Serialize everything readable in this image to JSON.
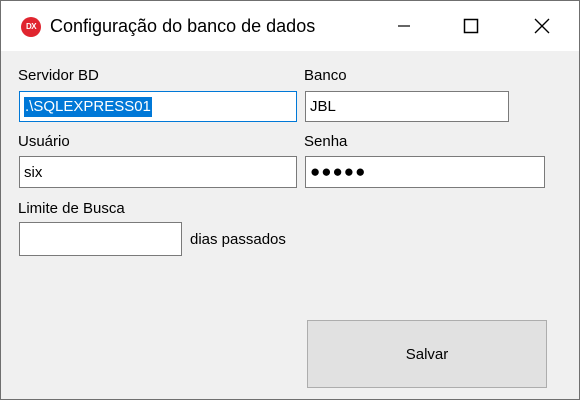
{
  "window": {
    "title": "Configuração do banco de dados",
    "icon_text": "DX",
    "icon_color": "#e0252f"
  },
  "form": {
    "servidor": {
      "label": "Servidor BD",
      "value": ".\\SQLEXPRESS01"
    },
    "banco": {
      "label": "Banco",
      "value": "JBL"
    },
    "usuario": {
      "label": "Usuário",
      "value": "six"
    },
    "senha": {
      "label": "Senha",
      "value": "●●●●●"
    },
    "limite": {
      "label": "Limite de Busca",
      "value": "",
      "suffix": "dias passados"
    }
  },
  "buttons": {
    "save_label": "Salvar"
  },
  "colors": {
    "selection": "#0078d7",
    "background": "#f0f0f0"
  }
}
